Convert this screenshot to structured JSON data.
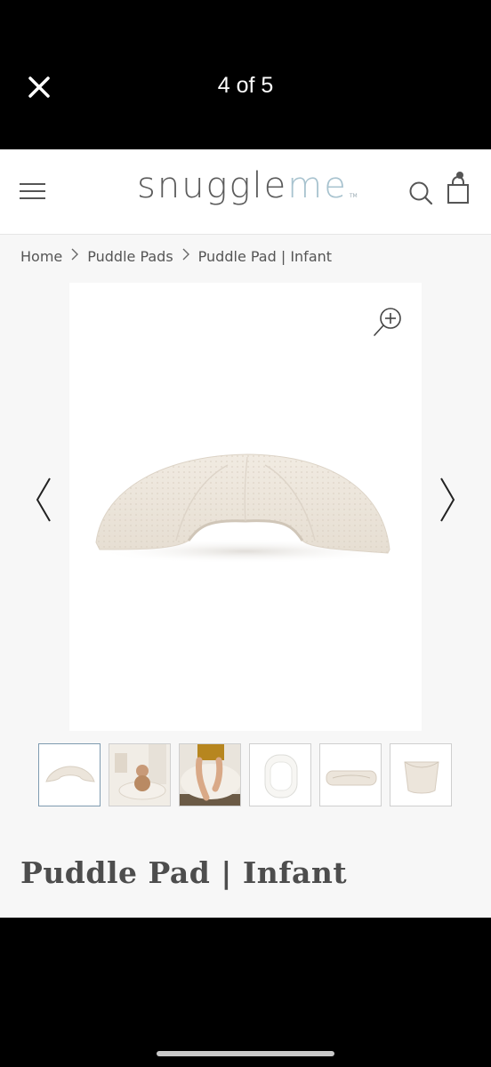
{
  "viewer": {
    "counter": "4 of 5",
    "close_icon": "close-icon"
  },
  "header": {
    "logo_primary": "snuggle",
    "logo_secondary": "me",
    "logo_tm": "TM",
    "icons": [
      "menu-icon",
      "search-icon",
      "shopping-bag-icon"
    ]
  },
  "breadcrumb": {
    "items": [
      "Home",
      "Puddle Pads",
      "Puddle Pad | Infant"
    ]
  },
  "gallery": {
    "zoom_icon": "zoom-in-icon",
    "prev_icon": "chevron-left-icon",
    "next_icon": "chevron-right-icon",
    "thumbnails": [
      {
        "name": "thumbnail-pad-front",
        "active": true
      },
      {
        "name": "thumbnail-baby-on-lounger",
        "active": false
      },
      {
        "name": "thumbnail-baby-legs",
        "active": false
      },
      {
        "name": "thumbnail-pad-top",
        "active": false
      },
      {
        "name": "thumbnail-pad-side",
        "active": false
      },
      {
        "name": "thumbnail-pad-folded",
        "active": false
      }
    ]
  },
  "product": {
    "title": "Puddle Pad | Infant"
  },
  "colors": {
    "logo_gray": "#5b5b5b",
    "logo_blue": "#a8c3cf",
    "fabric": "#ece5db",
    "active_thumb_border": "#7f9bb0"
  }
}
